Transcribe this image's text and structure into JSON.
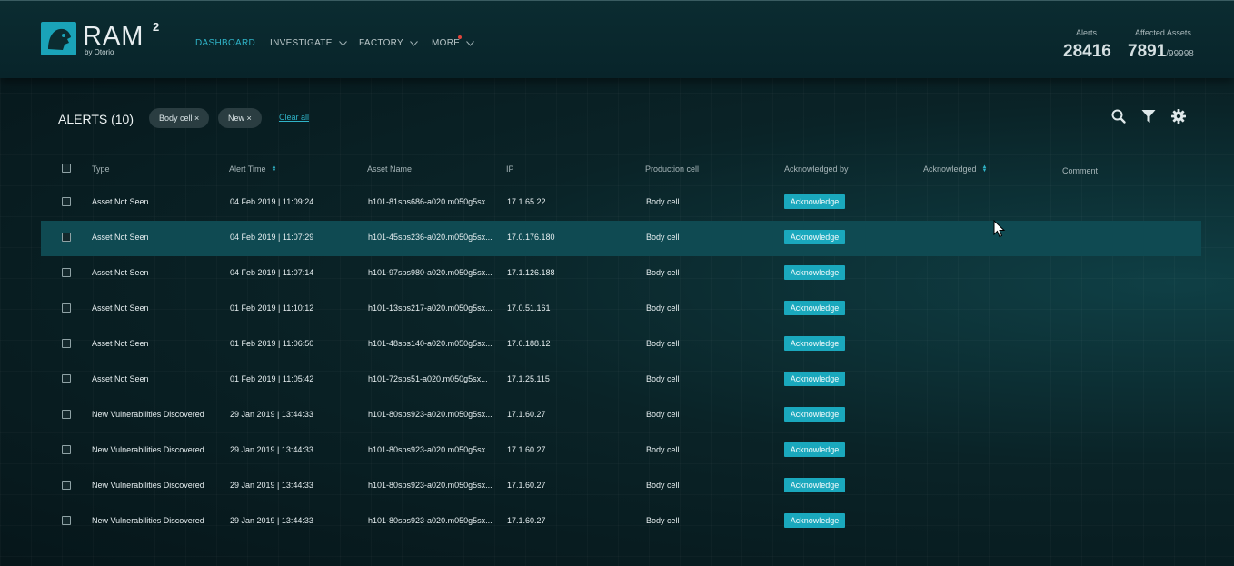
{
  "header": {
    "logo": {
      "word": "RAM",
      "sup": "2",
      "byline": "by Otorio"
    },
    "nav": [
      {
        "label": "DASHBOARD",
        "active": true,
        "has_chevron": false
      },
      {
        "label": "INVESTIGATE",
        "active": false,
        "has_chevron": true
      },
      {
        "label": "FACTORY",
        "active": false,
        "has_chevron": true
      },
      {
        "label": "MORE",
        "active": false,
        "has_chevron": true,
        "notification_dot": true
      }
    ],
    "stats": {
      "alerts_label": "Alerts",
      "alerts_value": "28416",
      "assets_label": "Affected Assets",
      "assets_value": "7891",
      "assets_total": "/99998"
    }
  },
  "alerts": {
    "title": "ALERTS (10)",
    "filters": [
      "Body cell ×",
      "New ×"
    ],
    "clear_label": "Clear all",
    "toolbar_icons": [
      "search-icon",
      "filter-icon",
      "gear-icon"
    ],
    "columns": [
      "Type",
      "Alert Time",
      "Asset Name",
      "IP",
      "Production cell",
      "Acknowledged by",
      "Acknowledged",
      "Comment"
    ],
    "sortable_columns": [
      "Alert Time",
      "Acknowledged"
    ],
    "ack_button_label": "Acknowledge",
    "highlighted_row": 1,
    "rows": [
      {
        "type": "Asset Not Seen",
        "time": "04 Feb 2019 | 11:09:24",
        "asset": "h101-81sps686-a020.m050g5sx...",
        "ip": "17.1.65.22",
        "cell": "Body cell"
      },
      {
        "type": "Asset Not Seen",
        "time": "04 Feb 2019 | 11:07:29",
        "asset": "h101-45sps236-a020.m050g5sx...",
        "ip": "17.0.176.180",
        "cell": "Body cell"
      },
      {
        "type": "Asset Not Seen",
        "time": "04 Feb 2019 | 11:07:14",
        "asset": "h101-97sps980-a020.m050g5sx...",
        "ip": "17.1.126.188",
        "cell": "Body cell"
      },
      {
        "type": "Asset Not Seen",
        "time": "01 Feb 2019 | 11:10:12",
        "asset": "h101-13sps217-a020.m050g5sx...",
        "ip": "17.0.51.161",
        "cell": "Body cell"
      },
      {
        "type": "Asset Not Seen",
        "time": "01 Feb 2019 | 11:06:50",
        "asset": "h101-48sps140-a020.m050g5sx...",
        "ip": "17.0.188.12",
        "cell": "Body cell"
      },
      {
        "type": "Asset Not Seen",
        "time": "01 Feb 2019 | 11:05:42",
        "asset": "h101-72sps51-a020.m050g5sx...",
        "ip": "17.1.25.115",
        "cell": "Body cell"
      },
      {
        "type": "New Vulnerabilities Discovered",
        "time": "29 Jan 2019 | 13:44:33",
        "asset": "h101-80sps923-a020.m050g5sx...",
        "ip": "17.1.60.27",
        "cell": "Body cell"
      },
      {
        "type": "New Vulnerabilities Discovered",
        "time": "29 Jan 2019 | 13:44:33",
        "asset": "h101-80sps923-a020.m050g5sx...",
        "ip": "17.1.60.27",
        "cell": "Body cell"
      },
      {
        "type": "New Vulnerabilities Discovered",
        "time": "29 Jan 2019 | 13:44:33",
        "asset": "h101-80sps923-a020.m050g5sx...",
        "ip": "17.1.60.27",
        "cell": "Body cell"
      },
      {
        "type": "New Vulnerabilities Discovered",
        "time": "29 Jan 2019 | 13:44:33",
        "asset": "h101-80sps923-a020.m050g5sx...",
        "ip": "17.1.60.27",
        "cell": "Body cell"
      }
    ]
  },
  "colors": {
    "accent": "#1aa8bd",
    "highlight_row": "#0f4a52",
    "notification": "#e2453c"
  }
}
